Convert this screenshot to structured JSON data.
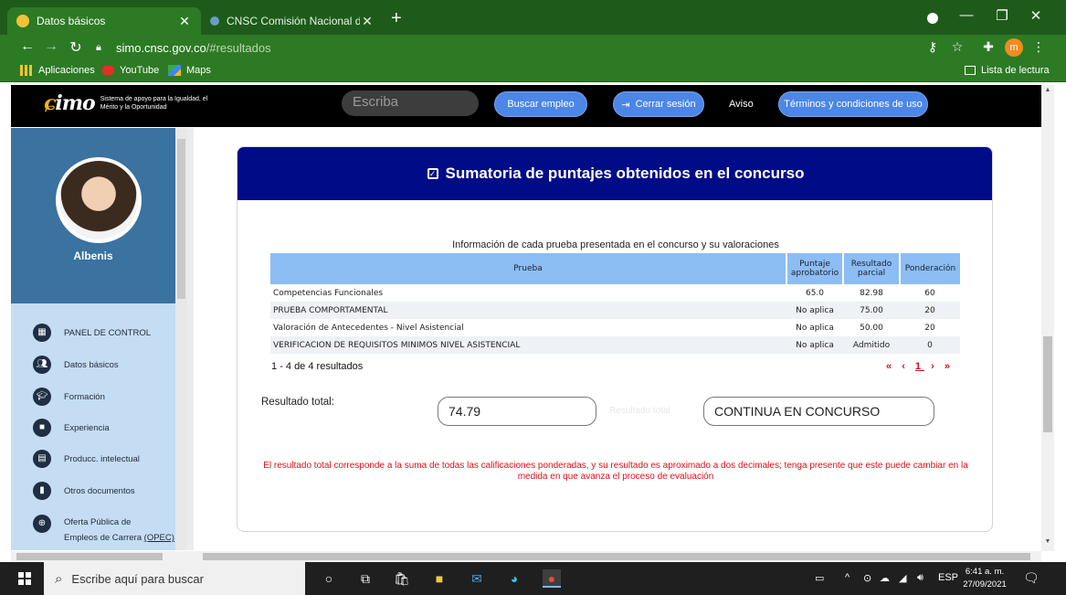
{
  "browser": {
    "tabs": [
      {
        "title": "Datos básicos",
        "active": true
      },
      {
        "title": "CNSC Comisión Nacional del Ser",
        "active": false
      }
    ],
    "url_host": "simo.cnsc.gov.co",
    "url_path": "/#resultados",
    "profile_initial": "m",
    "bookmarks": [
      "Aplicaciones",
      "YouTube",
      "Maps"
    ],
    "reading_list": "Lista de lectura"
  },
  "site": {
    "logo_text": "simo",
    "logo_tagline": "Sistema de apoyo para la Igualdad, el Mérito y la Oportunidad",
    "search_placeholder": "Escriba",
    "buttons": {
      "search_job": "Buscar empleo",
      "logout": "Cerrar sesión",
      "notice": "Aviso",
      "terms": "Términos y condiciones de uso"
    }
  },
  "sidebar": {
    "user_name": "Albenis",
    "items": [
      {
        "label": "PANEL DE CONTROL",
        "icon": "dashboard-icon"
      },
      {
        "label": "Datos básicos",
        "icon": "users-icon"
      },
      {
        "label": "Formación",
        "icon": "education-icon"
      },
      {
        "label": "Experiencia",
        "icon": "briefcase-icon"
      },
      {
        "label": "Producc. intelectual",
        "icon": "book-icon"
      },
      {
        "label": "Otros documentos",
        "icon": "document-icon"
      },
      {
        "label": "Oferta Pública de",
        "label2": "Empleos de Carrera",
        "label3": "(OPEC)",
        "icon": "globe-icon"
      }
    ]
  },
  "results": {
    "heading": "Sumatoria de puntajes obtenidos en el concurso",
    "table_caption": "Información de cada prueba presentada en el concurso y su valoraciones",
    "columns": [
      "Prueba",
      "Puntaje aprobatorio",
      "Resultado parcial",
      "Ponderación"
    ],
    "rows": [
      [
        "Competencias Funcionales",
        "65.0",
        "82.98",
        "60"
      ],
      [
        "PRUEBA COMPORTAMENTAL",
        "No aplica",
        "75.00",
        "20"
      ],
      [
        "Valoración de Antecedentes - Nivel Asistencial",
        "No aplica",
        "50.00",
        "20"
      ],
      [
        "VERIFICACION DE REQUISITOS MINIMOS NIVEL ASISTENCIAL",
        "No aplica",
        "Admitido",
        "0"
      ]
    ],
    "pager_info": "1 - 4 de 4 resultados",
    "pager": {
      "first": "«",
      "prev": "‹",
      "page": "1",
      "next": "›",
      "last": "»"
    },
    "total_label": "Resultado total:",
    "total_value": "74.79",
    "status_ghost_label": "Resultado total",
    "status_value": "CONTINUA EN CONCURSO",
    "note": "El resultado total corresponde a la suma de todas las calificaciones ponderadas, y su resultado es aproximado a dos decimales; tenga presente que este puede cambiar en la medida en que avanza el proceso de evaluación"
  },
  "taskbar": {
    "search_placeholder": "Escribe aquí para buscar",
    "language": "ESP",
    "time": "6:41 a. m.",
    "date": "27/09/2021"
  },
  "colors": {
    "chrome_green": "#2d7a25",
    "header_navy": "#000c87",
    "table_header": "#8cbdf3",
    "note_red": "#e0101a",
    "button_blue": "#4c86e6"
  }
}
